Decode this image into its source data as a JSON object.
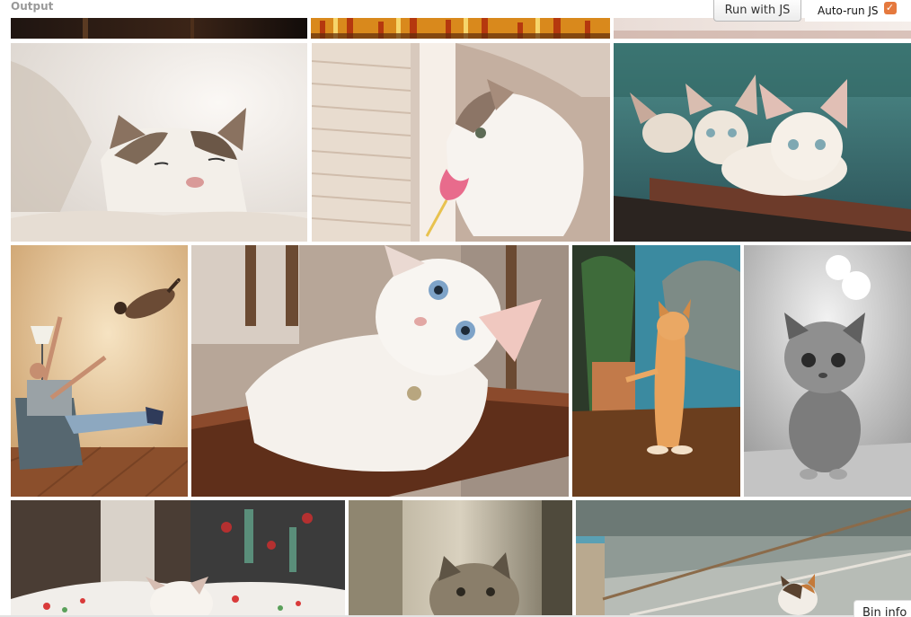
{
  "panel": {
    "label": "Output"
  },
  "toolbar": {
    "run_label": "Run with JS",
    "autorun_label": "Auto-run JS",
    "autorun_checked": true,
    "accent": "#e5793e"
  },
  "footer": {
    "bin_info_label": "Bin info"
  },
  "gallery": {
    "images": [
      {
        "name": "photo-dark-top-strip",
        "subject": "dark photo (cropped)"
      },
      {
        "name": "photo-colorful-top-strip",
        "subject": "colorful striped photo (cropped)"
      },
      {
        "name": "photo-pale-top-strip",
        "subject": "pale photo (cropped)"
      },
      {
        "name": "photo-sleeping-kitten",
        "subject": "kitten sleeping with eyes closed"
      },
      {
        "name": "photo-kitten-pink-toy",
        "subject": "kitten biting pink toy by scratching post"
      },
      {
        "name": "photo-three-siamese-kittens",
        "subject": "three white kittens on a bench"
      },
      {
        "name": "photo-man-tossing-cat",
        "subject": "man in armchair with cat in mid-air"
      },
      {
        "name": "photo-white-kitten-lying",
        "subject": "white kitten lying on wooden shelf"
      },
      {
        "name": "photo-orange-kitten-standing",
        "subject": "orange kitten standing on hind legs"
      },
      {
        "name": "photo-bw-kitten",
        "subject": "black and white fluffy kitten"
      },
      {
        "name": "photo-kitten-on-pillow",
        "subject": "white kitten on pillows"
      },
      {
        "name": "photo-tabby-kitten-sepia",
        "subject": "tabby kitten sepia tone"
      },
      {
        "name": "photo-calico-kitten-boat",
        "subject": "calico kitten near rope and post"
      }
    ]
  }
}
